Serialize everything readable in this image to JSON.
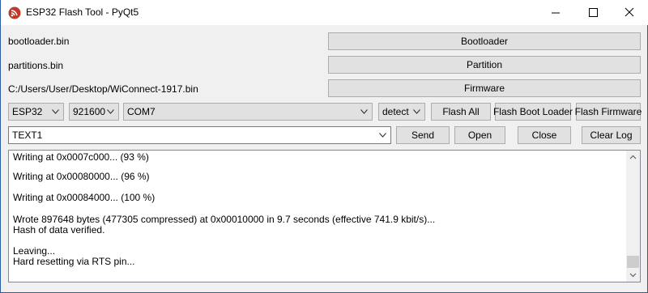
{
  "window": {
    "title": "ESP32 Flash Tool - PyQt5",
    "controls": {
      "minimize": "minimize-icon",
      "maximize": "maximize-icon",
      "close": "close-icon"
    }
  },
  "files": {
    "bootloader_path": "bootloader.bin",
    "partitions_path": "partitions.bin",
    "firmware_path": "C:/Users/User/Desktop/WiConnect-1917.bin",
    "bootloader_button": "Bootloader",
    "partition_button": "Partition",
    "firmware_button": "Firmware"
  },
  "flash_options": {
    "chip": "ESP32",
    "baud": "921600",
    "port": "COM7",
    "mode": "detect",
    "flash_all_button": "Flash All",
    "flash_boot_loader_button": "Flash Boot Loader",
    "flash_firmware_button": "Flash Firmware"
  },
  "serial": {
    "text_value": "TEXT1",
    "send_button": "Send",
    "open_button": "Open",
    "close_button": "Close",
    "clear_log_button": "Clear Log"
  },
  "log": {
    "lines": [
      "Writing at 0x0007c000... (93 %)",
      "Writing at 0x00080000... (96 %)",
      "Writing at 0x00084000... (100 %)",
      "Wrote 897648 bytes (477305 compressed) at 0x00010000 in 9.7 seconds (effective 741.9 kbit/s)...",
      "Hash of data verified.",
      "Leaving...",
      "Hard resetting via RTS pin..."
    ]
  },
  "colors": {
    "accent": "#2b5ea0",
    "button_face": "#e1e1e1",
    "button_border": "#adadad",
    "app_icon": "#c0392b"
  }
}
